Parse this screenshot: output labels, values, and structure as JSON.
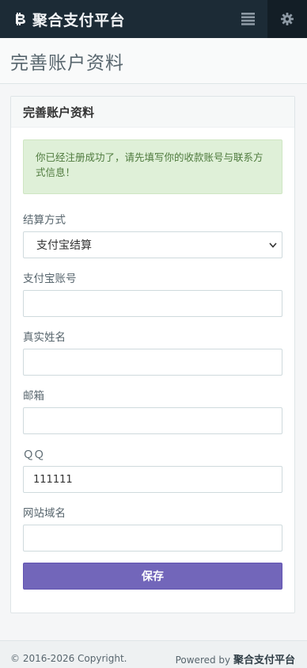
{
  "app": {
    "title": "聚合支付平台"
  },
  "header": {
    "menu_icon": "list-icon",
    "settings_icon": "gear-icon"
  },
  "page": {
    "title": "完善账户资料"
  },
  "panel": {
    "heading": "完善账户资料"
  },
  "alert": {
    "message": "你已经注册成功了，请先填写你的收款账号与联系方式信息！"
  },
  "form": {
    "settlement": {
      "label": "结算方式",
      "selected": "支付宝结算"
    },
    "alipay_account": {
      "label": "支付宝账号",
      "value": ""
    },
    "real_name": {
      "label": "真实姓名",
      "value": ""
    },
    "email": {
      "label": "邮箱",
      "value": ""
    },
    "qq": {
      "label": "ＱＱ",
      "value": "111111"
    },
    "website": {
      "label": "网站域名",
      "value": ""
    },
    "save_label": "保存"
  },
  "footer": {
    "copyright": "© 2016-2026 Copyright.",
    "powered_by": "Powered by",
    "brand": "聚合支付平台"
  },
  "colors": {
    "navbar": "#1c2b36",
    "primary": "#7266ba",
    "alert_bg": "#dff0d8"
  }
}
